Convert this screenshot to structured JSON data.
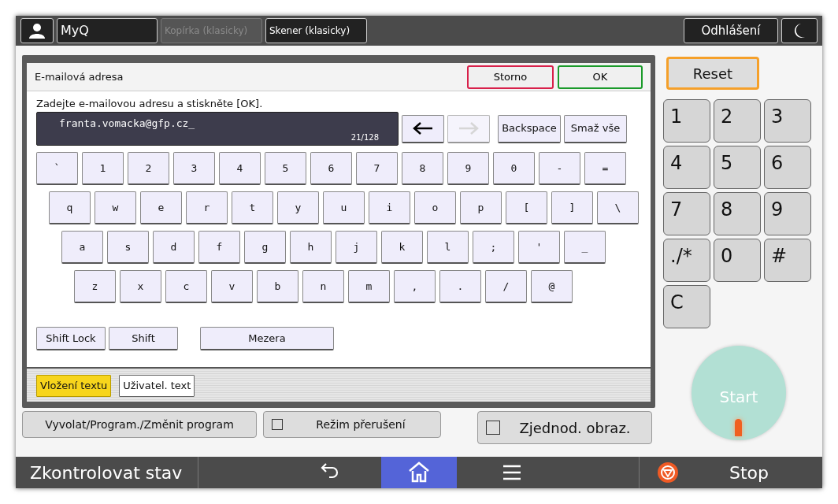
{
  "top_bar": {
    "apps": [
      {
        "label": "MyQ",
        "disabled": false
      },
      {
        "label": "Kopírka (klasicky)",
        "disabled": true
      },
      {
        "label": "Skener (klasicky)",
        "disabled": false
      }
    ],
    "logout": "Odhlášení"
  },
  "dialog": {
    "title": "E-mailová adresa",
    "cancel": "Storno",
    "ok": "OK",
    "instruction": "Zadejte e-mailovou adresu a stiskněte [OK].",
    "input": {
      "value": "franta.vomacka@gfp.cz_",
      "counter": "21/128"
    },
    "cursor_buttons": [
      {
        "kind": "left",
        "disabled": false
      },
      {
        "kind": "right",
        "disabled": true
      }
    ],
    "edit_buttons": [
      "Backspace",
      "Smaž vše"
    ],
    "key_rows": [
      [
        "`",
        "1",
        "2",
        "3",
        "4",
        "5",
        "6",
        "7",
        "8",
        "9",
        "0",
        "-",
        "="
      ],
      [
        "q",
        "w",
        "e",
        "r",
        "t",
        "y",
        "u",
        "i",
        "o",
        "p",
        "[",
        "]",
        "\\"
      ],
      [
        "a",
        "s",
        "d",
        "f",
        "g",
        "h",
        "j",
        "k",
        "l",
        ";",
        "'",
        "_"
      ],
      [
        "z",
        "x",
        "c",
        "v",
        "b",
        "n",
        "m",
        ",",
        ".",
        "/",
        "@"
      ]
    ],
    "shift_keys": [
      "Shift Lock",
      "Shift"
    ],
    "space": "Mezera",
    "tabs": [
      {
        "label": "Vložení textu",
        "selected": true
      },
      {
        "label": "Uživatel. text",
        "selected": false
      }
    ]
  },
  "actions": {
    "program": "Vyvolat/Program./Změnit program",
    "interrupt": {
      "label": "Režim přerušení",
      "checked": false
    },
    "simple": {
      "label": "Zjednod. obraz.",
      "checked": false
    }
  },
  "keypad": {
    "reset": "Reset",
    "keys": [
      "1",
      "2",
      "3",
      "4",
      "5",
      "6",
      "7",
      "8",
      "9",
      "./*",
      "0",
      "#",
      "C"
    ],
    "start": "Start"
  },
  "bottom_bar": {
    "status": "Zkontrolovat stav",
    "nav": [
      {
        "kind": "back",
        "selected": false
      },
      {
        "kind": "home",
        "selected": true
      },
      {
        "kind": "menu",
        "selected": false
      }
    ],
    "stop": "Stop"
  }
}
